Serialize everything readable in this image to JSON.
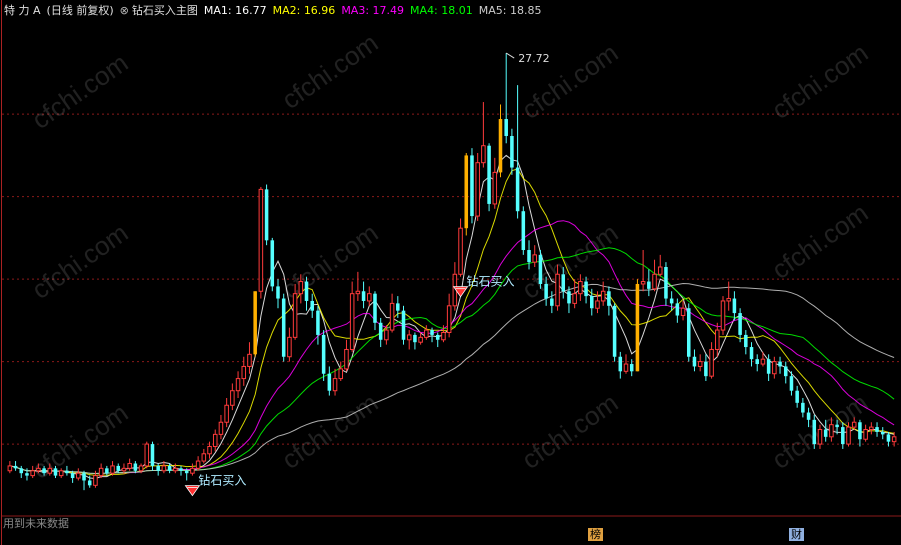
{
  "header": {
    "stock_name": "特 力 A",
    "period": "(日线 前复权)",
    "indicator_symbol": "⊗",
    "indicator_name": "钻石买入主图",
    "ma": [
      {
        "label": "MA1:",
        "value": "16.77",
        "color": "#ffffff"
      },
      {
        "label": "MA2:",
        "value": "16.96",
        "color": "#ffff00"
      },
      {
        "label": "MA3:",
        "value": "17.49",
        "color": "#ff00ff"
      },
      {
        "label": "MA4:",
        "value": "18.01",
        "color": "#00ff00"
      },
      {
        "label": "MA5:",
        "value": "18.85",
        "color": "#cccccc"
      }
    ]
  },
  "footer": {
    "note": "用到未来数据"
  },
  "badges": [
    {
      "text": "榜",
      "color": "#e0a040"
    },
    {
      "text": "财",
      "color": "#90b0e0"
    }
  ],
  "signals": [
    {
      "label": "钻石买入",
      "index": 32
    },
    {
      "label": "钻石买入",
      "index": 79
    }
  ],
  "watermark": "cfchi.com",
  "chart_data": {
    "type": "candlestick",
    "title": "钻石买入主图",
    "ylim": [
      8.8,
      29.0
    ],
    "gridlines": [
      25.2,
      21.8,
      18.4,
      15.0,
      11.6
    ],
    "max_annotation": {
      "label": "27.72",
      "value": 27.72,
      "index": 87
    },
    "colors": {
      "up": "#ff3b3b",
      "down": "#55ffff",
      "limit_up": "#ffb000",
      "grid": "#8b1a1a",
      "axis": "#aa2222"
    },
    "candles": [
      [
        10.5,
        10.7,
        10.9,
        10.4,
        0
      ],
      [
        10.7,
        10.6,
        10.9,
        10.5,
        0
      ],
      [
        10.6,
        10.4,
        10.7,
        10.2,
        0
      ],
      [
        10.4,
        10.3,
        10.6,
        10.1,
        0
      ],
      [
        10.3,
        10.5,
        10.7,
        10.2,
        0
      ],
      [
        10.5,
        10.6,
        10.8,
        10.4,
        0
      ],
      [
        10.6,
        10.4,
        10.7,
        10.3,
        0
      ],
      [
        10.4,
        10.6,
        10.8,
        10.3,
        0
      ],
      [
        10.6,
        10.3,
        10.7,
        10.2,
        0
      ],
      [
        10.3,
        10.5,
        10.6,
        10.2,
        0
      ],
      [
        10.5,
        10.4,
        10.7,
        10.3,
        0
      ],
      [
        10.4,
        10.2,
        10.5,
        10.0,
        0
      ],
      [
        10.2,
        10.4,
        10.6,
        10.1,
        0
      ],
      [
        10.4,
        10.1,
        10.5,
        9.7,
        0
      ],
      [
        10.1,
        9.9,
        10.3,
        9.8,
        0
      ],
      [
        9.9,
        10.3,
        10.5,
        9.8,
        0
      ],
      [
        10.3,
        10.6,
        10.8,
        10.2,
        0
      ],
      [
        10.6,
        10.4,
        10.7,
        10.3,
        0
      ],
      [
        10.4,
        10.7,
        10.9,
        10.3,
        0
      ],
      [
        10.7,
        10.5,
        10.8,
        10.4,
        0
      ],
      [
        10.5,
        10.6,
        10.8,
        10.4,
        0
      ],
      [
        10.6,
        10.8,
        11.0,
        10.5,
        0
      ],
      [
        10.8,
        10.5,
        10.9,
        10.4,
        0
      ],
      [
        10.5,
        10.7,
        10.8,
        10.4,
        0
      ],
      [
        10.7,
        11.6,
        11.7,
        10.6,
        0
      ],
      [
        11.6,
        10.7,
        11.7,
        10.5,
        0
      ],
      [
        10.7,
        10.5,
        10.8,
        10.3,
        0
      ],
      [
        10.5,
        10.7,
        10.9,
        10.4,
        0
      ],
      [
        10.7,
        10.5,
        10.8,
        10.4,
        0
      ],
      [
        10.5,
        10.6,
        10.8,
        10.4,
        0
      ],
      [
        10.6,
        10.5,
        10.7,
        10.3,
        0
      ],
      [
        10.5,
        10.4,
        10.6,
        10.1,
        0
      ],
      [
        10.4,
        10.6,
        10.8,
        10.3,
        0
      ],
      [
        10.6,
        10.9,
        11.1,
        10.5,
        0
      ],
      [
        10.9,
        11.2,
        11.4,
        10.8,
        0
      ],
      [
        11.2,
        11.5,
        11.7,
        11.0,
        0
      ],
      [
        11.5,
        12.0,
        12.2,
        11.3,
        0
      ],
      [
        12.0,
        12.5,
        12.8,
        11.8,
        0
      ],
      [
        12.5,
        13.2,
        13.5,
        12.3,
        0
      ],
      [
        13.2,
        13.8,
        14.1,
        13.0,
        0
      ],
      [
        13.8,
        14.3,
        14.6,
        13.5,
        0
      ],
      [
        14.3,
        14.8,
        15.2,
        14.0,
        0
      ],
      [
        14.8,
        15.3,
        15.8,
        14.5,
        0
      ],
      [
        15.3,
        17.9,
        17.9,
        15.2,
        1
      ],
      [
        17.9,
        22.1,
        22.2,
        17.6,
        0
      ],
      [
        22.1,
        20.0,
        22.3,
        19.8,
        0
      ],
      [
        20.0,
        18.1,
        20.1,
        17.9,
        0
      ],
      [
        18.1,
        17.6,
        18.4,
        17.2,
        0
      ],
      [
        17.6,
        15.2,
        17.8,
        15.0,
        0
      ],
      [
        15.2,
        16.0,
        16.4,
        15.0,
        0
      ],
      [
        16.0,
        17.8,
        18.2,
        15.9,
        0
      ],
      [
        17.8,
        18.3,
        18.6,
        17.4,
        0
      ],
      [
        18.3,
        17.5,
        18.5,
        17.1,
        0
      ],
      [
        17.5,
        17.1,
        17.8,
        16.8,
        0
      ],
      [
        17.1,
        16.1,
        17.3,
        15.7,
        0
      ],
      [
        16.1,
        14.5,
        16.3,
        14.2,
        0
      ],
      [
        14.5,
        13.8,
        14.8,
        13.6,
        0
      ],
      [
        13.8,
        14.3,
        14.7,
        13.6,
        0
      ],
      [
        14.3,
        14.7,
        15.0,
        14.2,
        0
      ],
      [
        14.7,
        15.5,
        15.9,
        14.6,
        0
      ],
      [
        15.5,
        17.8,
        18.3,
        15.4,
        0
      ],
      [
        17.8,
        17.9,
        18.7,
        17.5,
        0
      ],
      [
        17.9,
        17.5,
        18.3,
        17.2,
        0
      ],
      [
        17.5,
        17.8,
        18.1,
        17.3,
        0
      ],
      [
        17.8,
        16.6,
        17.9,
        16.3,
        0
      ],
      [
        16.6,
        15.9,
        16.8,
        15.6,
        0
      ],
      [
        15.9,
        16.3,
        16.5,
        15.7,
        0
      ],
      [
        16.3,
        17.4,
        17.8,
        16.2,
        0
      ],
      [
        17.4,
        17.1,
        17.7,
        16.8,
        0
      ],
      [
        17.1,
        15.9,
        17.3,
        15.7,
        0
      ],
      [
        15.9,
        16.1,
        16.3,
        15.5,
        0
      ],
      [
        16.1,
        15.8,
        16.2,
        15.5,
        0
      ],
      [
        15.8,
        16.0,
        16.2,
        15.7,
        0
      ],
      [
        16.0,
        16.3,
        16.5,
        15.9,
        0
      ],
      [
        16.3,
        16.1,
        16.4,
        15.8,
        0
      ],
      [
        16.1,
        15.9,
        16.2,
        15.6,
        0
      ],
      [
        15.9,
        16.2,
        16.5,
        15.8,
        0
      ],
      [
        16.2,
        17.3,
        17.8,
        16.0,
        0
      ],
      [
        17.3,
        18.6,
        19.1,
        17.1,
        0
      ],
      [
        18.6,
        20.5,
        20.9,
        18.5,
        0
      ],
      [
        20.5,
        23.5,
        23.6,
        20.2,
        1
      ],
      [
        23.5,
        21.0,
        23.8,
        20.7,
        0
      ],
      [
        21.0,
        23.2,
        23.6,
        20.8,
        0
      ],
      [
        23.2,
        23.9,
        25.7,
        23.0,
        0
      ],
      [
        23.9,
        21.5,
        24.0,
        21.2,
        0
      ],
      [
        21.5,
        22.8,
        23.4,
        21.3,
        0
      ],
      [
        22.8,
        25.0,
        25.6,
        22.6,
        1
      ],
      [
        25.0,
        24.3,
        27.72,
        24.0,
        0
      ],
      [
        24.3,
        23.0,
        24.6,
        22.7,
        0
      ],
      [
        23.0,
        21.2,
        26.4,
        20.9,
        0
      ],
      [
        21.2,
        19.6,
        21.4,
        19.4,
        0
      ],
      [
        19.6,
        19.1,
        20.0,
        18.8,
        0
      ],
      [
        19.1,
        19.4,
        19.8,
        18.9,
        0
      ],
      [
        19.4,
        18.2,
        19.6,
        18.0,
        0
      ],
      [
        18.2,
        17.6,
        18.5,
        17.3,
        0
      ],
      [
        17.6,
        17.3,
        17.9,
        17.0,
        0
      ],
      [
        17.3,
        18.6,
        19.0,
        17.1,
        0
      ],
      [
        18.6,
        17.9,
        18.9,
        17.6,
        0
      ],
      [
        17.9,
        17.4,
        18.1,
        17.0,
        0
      ],
      [
        17.4,
        17.8,
        18.4,
        17.2,
        0
      ],
      [
        17.8,
        18.3,
        18.6,
        17.5,
        0
      ],
      [
        18.3,
        17.7,
        18.5,
        17.4,
        0
      ],
      [
        17.7,
        17.2,
        18.0,
        16.9,
        0
      ],
      [
        17.2,
        17.5,
        17.9,
        17.0,
        0
      ],
      [
        17.5,
        17.9,
        18.3,
        17.3,
        0
      ],
      [
        17.9,
        17.3,
        18.1,
        16.9,
        0
      ],
      [
        17.3,
        15.2,
        17.4,
        15.0,
        0
      ],
      [
        15.2,
        14.6,
        15.4,
        14.3,
        0
      ],
      [
        14.6,
        14.9,
        15.3,
        14.5,
        0
      ],
      [
        14.9,
        14.6,
        15.1,
        14.4,
        0
      ],
      [
        14.6,
        18.2,
        18.4,
        14.6,
        1
      ],
      [
        18.2,
        18.3,
        19.6,
        17.9,
        0
      ],
      [
        18.3,
        18.0,
        18.8,
        17.7,
        0
      ],
      [
        18.0,
        18.6,
        19.2,
        17.9,
        0
      ],
      [
        18.6,
        18.9,
        19.4,
        18.5,
        0
      ],
      [
        18.9,
        17.6,
        19.1,
        17.3,
        0
      ],
      [
        17.6,
        17.4,
        17.9,
        17.1,
        0
      ],
      [
        17.4,
        16.9,
        17.6,
        16.6,
        0
      ],
      [
        16.9,
        17.2,
        17.5,
        16.7,
        0
      ],
      [
        17.2,
        15.2,
        17.4,
        15.0,
        0
      ],
      [
        15.2,
        14.8,
        15.5,
        14.6,
        0
      ],
      [
        14.8,
        15.0,
        15.3,
        14.6,
        0
      ],
      [
        15.0,
        14.4,
        15.3,
        14.2,
        0
      ],
      [
        14.4,
        15.5,
        15.8,
        14.3,
        0
      ],
      [
        15.5,
        16.3,
        16.6,
        15.2,
        0
      ],
      [
        16.3,
        17.5,
        17.7,
        16.1,
        0
      ],
      [
        17.5,
        17.6,
        18.3,
        17.1,
        0
      ],
      [
        17.6,
        17.0,
        17.9,
        16.7,
        0
      ],
      [
        17.0,
        16.1,
        17.2,
        15.8,
        0
      ],
      [
        16.1,
        15.6,
        16.3,
        15.3,
        0
      ],
      [
        15.6,
        15.1,
        15.8,
        14.8,
        0
      ],
      [
        15.1,
        14.9,
        15.3,
        14.6,
        0
      ],
      [
        14.9,
        15.1,
        15.4,
        14.8,
        0
      ],
      [
        15.1,
        14.5,
        15.3,
        14.2,
        0
      ],
      [
        14.5,
        15.0,
        15.2,
        14.3,
        0
      ],
      [
        15.0,
        14.8,
        15.2,
        14.5,
        0
      ],
      [
        14.8,
        14.4,
        15.0,
        14.1,
        0
      ],
      [
        14.4,
        13.8,
        14.6,
        13.6,
        0
      ],
      [
        13.8,
        13.3,
        14.0,
        13.1,
        0
      ],
      [
        13.3,
        12.9,
        13.5,
        12.7,
        0
      ],
      [
        12.9,
        12.6,
        13.1,
        12.3,
        0
      ],
      [
        12.6,
        11.6,
        12.8,
        11.4,
        0
      ],
      [
        11.6,
        12.2,
        12.4,
        11.4,
        0
      ],
      [
        12.2,
        11.9,
        12.6,
        11.7,
        0
      ],
      [
        11.9,
        12.4,
        12.7,
        11.7,
        0
      ],
      [
        12.4,
        12.3,
        12.6,
        12.0,
        0
      ],
      [
        12.3,
        11.6,
        12.5,
        11.4,
        0
      ],
      [
        11.6,
        12.3,
        12.5,
        11.5,
        0
      ],
      [
        12.3,
        12.5,
        12.7,
        12.2,
        0
      ],
      [
        12.5,
        11.8,
        12.6,
        11.5,
        0
      ],
      [
        11.8,
        12.2,
        12.4,
        11.7,
        0
      ],
      [
        12.2,
        12.3,
        12.5,
        12.0,
        0
      ],
      [
        12.3,
        12.1,
        12.5,
        11.9,
        0
      ],
      [
        12.1,
        12.0,
        12.3,
        11.8,
        0
      ],
      [
        12.0,
        11.7,
        12.1,
        11.5,
        0
      ],
      [
        11.7,
        11.9,
        12.1,
        11.5,
        0
      ]
    ]
  }
}
